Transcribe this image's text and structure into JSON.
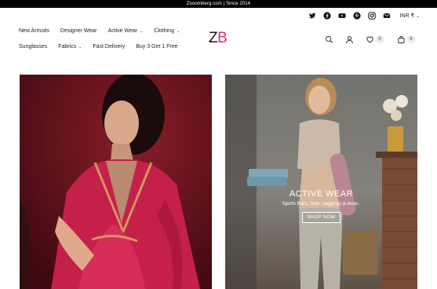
{
  "announcement": "Zooomberg.com | Since 2014",
  "social": {
    "icons": [
      "twitter-icon",
      "facebook-icon",
      "youtube-icon",
      "pinterest-icon",
      "instagram-icon",
      "mail-icon"
    ],
    "currency": "INR ₹"
  },
  "nav": {
    "row1": [
      {
        "label": "New Arrivals",
        "dropdown": false
      },
      {
        "label": "Designer Wear",
        "dropdown": false
      },
      {
        "label": "Active Wear",
        "dropdown": true
      },
      {
        "label": "Clothing",
        "dropdown": true
      }
    ],
    "row2": [
      {
        "label": "Sunglasses",
        "dropdown": false
      },
      {
        "label": "Fabrics",
        "dropdown": true
      },
      {
        "label": "Fast Delivery",
        "dropdown": false
      },
      {
        "label": "Buy 3 Get 1 Free",
        "dropdown": false
      }
    ]
  },
  "logo": {
    "z": "Z",
    "b": "B"
  },
  "actions": {
    "wishlist_count": "0",
    "cart_count": "0"
  },
  "hero_right": {
    "title": "ACTIVE WEAR",
    "subtitle": "Sports Bra's, Sets, Leggings & more..",
    "button": "SHOP NOW"
  },
  "colors": {
    "brand_pink": "#e32b6f",
    "announce_bg": "#000000"
  }
}
